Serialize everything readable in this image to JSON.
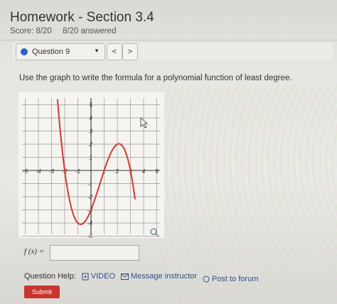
{
  "header": {
    "title": "Homework - Section 3.4",
    "score": "Score: 8/20",
    "answered": "8/20 answered"
  },
  "question_nav": {
    "selected": "Question 9",
    "prev_label": "<",
    "next_label": ">"
  },
  "prompt": "Use the graph to write the formula for a polynomial function of least degree.",
  "graph": {
    "x_ticks": [
      "-5",
      "-4",
      "-3",
      "-2",
      "-1",
      "1",
      "2",
      "3",
      "4",
      "5"
    ],
    "y_ticks": [
      "5",
      "4",
      "3",
      "2",
      "1",
      "-1",
      "-2",
      "-3",
      "-4",
      "-5"
    ],
    "curve_color": "#d23a32"
  },
  "answer": {
    "label": "f (x) =",
    "value": ""
  },
  "help": {
    "label": "Question Help:",
    "video": "VIDEO",
    "message": "Message instructor",
    "forum": "Post to forum"
  },
  "submit_label": "Submit"
}
